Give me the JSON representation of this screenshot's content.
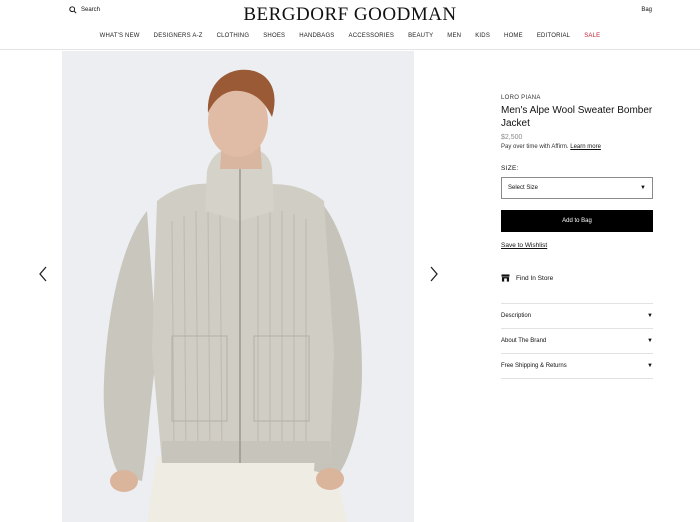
{
  "header": {
    "search_label": "Search",
    "logo": "BERGDORF GOODMAN",
    "bag_label": "Bag",
    "nav": [
      "WHAT'S NEW",
      "DESIGNERS A-Z",
      "CLOTHING",
      "SHOES",
      "HANDBAGS",
      "ACCESSORIES",
      "BEAUTY",
      "MEN",
      "KIDS",
      "HOME",
      "EDITORIAL",
      "SALE"
    ]
  },
  "gallery": {
    "image_alt": "Model wearing grey ribbed zip-up knit sweater jacket",
    "prev_icon": "chevron-left-icon",
    "next_icon": "chevron-right-icon"
  },
  "product": {
    "brand": "LORO PIANA",
    "title": "Men's Alpe Wool Sweater Bomber Jacket",
    "price": "$2,500",
    "affirm_text": "Pay over time with Affirm.",
    "affirm_link": "Learn more",
    "size_label": "SIZE:",
    "size_select": "Select Size",
    "add_to_bag": "Add to Bag",
    "wishlist": "Save to Wishlist",
    "find_in_store": "Find In Store",
    "accordion": [
      "Description",
      "About The Brand",
      "Free Shipping & Returns"
    ]
  },
  "colors": {
    "sale": "#c41e3a",
    "button_bg": "#000000"
  }
}
